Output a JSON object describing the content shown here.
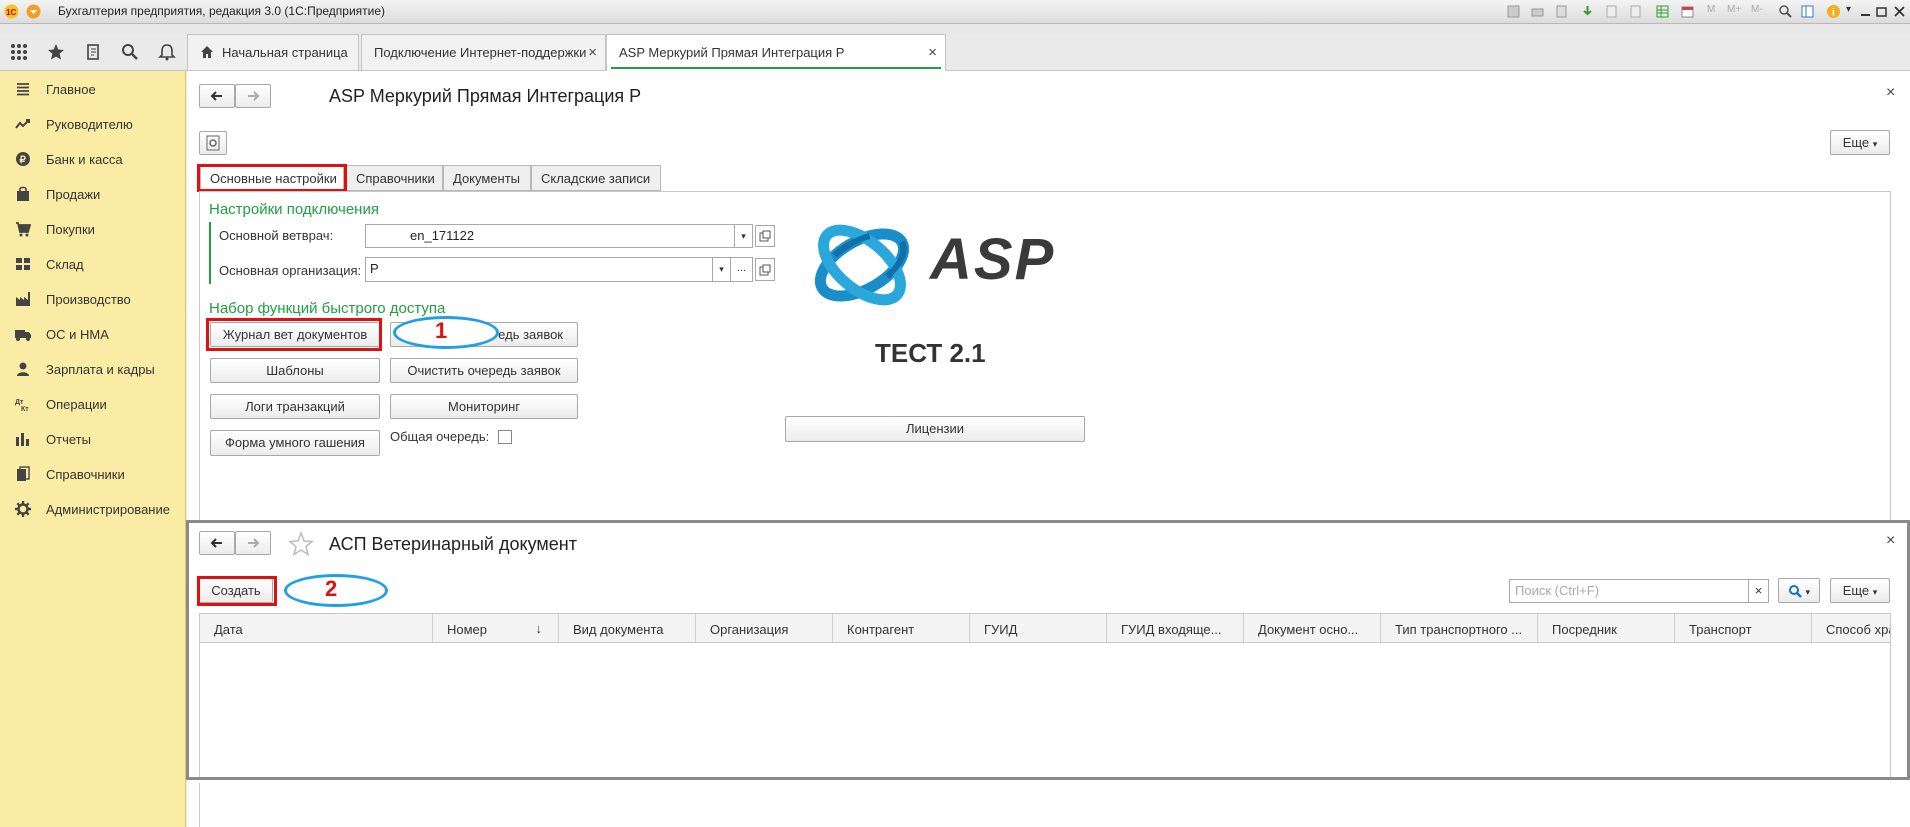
{
  "window": {
    "title": "Бухгалтерия предприятия, редакция 3.0  (1С:Предприятие)"
  },
  "tabs": [
    {
      "label": "Начальная страница"
    },
    {
      "label": "Подключение Интернет-поддержки"
    },
    {
      "label": "ASP Меркурий Прямая Интеграция Р"
    }
  ],
  "sidebar": {
    "items": [
      {
        "label": "Главное",
        "icon": "menu-lines-icon"
      },
      {
        "label": "Руководителю",
        "icon": "trend-icon"
      },
      {
        "label": "Банк и касса",
        "icon": "ruble-coin-icon"
      },
      {
        "label": "Продажи",
        "icon": "shopping-bag-icon"
      },
      {
        "label": "Покупки",
        "icon": "cart-icon"
      },
      {
        "label": "Склад",
        "icon": "warehouse-grid-icon"
      },
      {
        "label": "Производство",
        "icon": "factory-icon"
      },
      {
        "label": "ОС и НМА",
        "icon": "truck-icon"
      },
      {
        "label": "Зарплата и кадры",
        "icon": "person-icon"
      },
      {
        "label": "Операции",
        "icon": "dt-kt-icon"
      },
      {
        "label": "Отчеты",
        "icon": "bar-chart-icon"
      },
      {
        "label": "Справочники",
        "icon": "books-icon"
      },
      {
        "label": "Администрирование",
        "icon": "gear-icon"
      }
    ]
  },
  "form1": {
    "title": "ASP Меркурий Прямая Интеграция Р",
    "more": "Еще",
    "tabs": [
      "Основные настройки",
      "Справочники",
      "Документы",
      "Складские записи"
    ],
    "connection_header": "Настройки подключения",
    "vet_label": "Основной ветврач:",
    "vet_value": "en_171122",
    "org_label": "Основная организация:",
    "org_value": "Р",
    "quick_header": "Набор функций быстрого доступа",
    "buttons": {
      "journal": "Журнал вет документов",
      "queue": "едь заявок",
      "templates": "Шаблоны",
      "clear_queue": "Очистить очередь заявок",
      "logs": "Логи транзакций",
      "monitoring": "Мониторинг",
      "smart": "Форма умного гашения"
    },
    "common_queue_label": "Общая очередь:",
    "logo_text": "ASP",
    "test_label": "ТЕСТ 2.1",
    "licenses": "Лицензии",
    "annotation": "1"
  },
  "form2": {
    "title": "АСП Ветеринарный документ",
    "create": "Создать",
    "annotation": "2",
    "search_placeholder": "Поиск (Ctrl+F)",
    "more": "Еще",
    "columns": [
      "Дата",
      "Номер",
      "Вид документа",
      "Организация",
      "Контрагент",
      "ГУИД",
      "ГУИД входяще...",
      "Документ осно...",
      "Тип транспортного ...",
      "Посредник",
      "Транспорт",
      "Способ хра"
    ]
  },
  "colors": {
    "sidebar": "#fbeca5",
    "accent_green": "#20a040",
    "annotation_red": "#e01010",
    "annotation_blue": "#20a0e0",
    "logo_blue": "#1a8ec8"
  }
}
